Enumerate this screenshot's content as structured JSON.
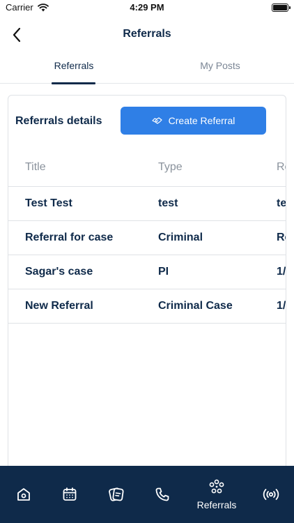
{
  "status_bar": {
    "carrier": "Carrier",
    "time": "4:29 PM",
    "wifi_icon": "wifi-icon",
    "battery_icon": "battery-icon",
    "battery_level": 1.0
  },
  "nav": {
    "title": "Referrals",
    "back_icon": "chevron-left-icon"
  },
  "tabs": [
    {
      "label": "Referrals",
      "active": true
    },
    {
      "label": "My Posts",
      "active": false
    }
  ],
  "card": {
    "title": "Referrals details",
    "create_button": {
      "label": "Create Referral",
      "icon": "handshake-icon"
    }
  },
  "table": {
    "columns": [
      "Title",
      "Type",
      "Re"
    ],
    "rows": [
      [
        "Test Test",
        "test",
        "te"
      ],
      [
        "Referral for case",
        "Criminal",
        "Re"
      ],
      [
        "Sagar's case",
        "PI",
        "1/"
      ],
      [
        "New Referral",
        "Criminal Case",
        "1/"
      ]
    ]
  },
  "bottom_tabs": [
    {
      "icon": "home-icon",
      "label": ""
    },
    {
      "icon": "calendar-icon",
      "label": ""
    },
    {
      "icon": "notes-icon",
      "label": ""
    },
    {
      "icon": "phone-icon",
      "label": ""
    },
    {
      "icon": "referrals-icon",
      "label": "Referrals",
      "active": true
    },
    {
      "icon": "broadcast-icon",
      "label": ""
    }
  ],
  "colors": {
    "navy": "#0f2a4a",
    "accent": "#2f7fe6",
    "muted": "#8a929c",
    "border": "#dfe2e6"
  }
}
